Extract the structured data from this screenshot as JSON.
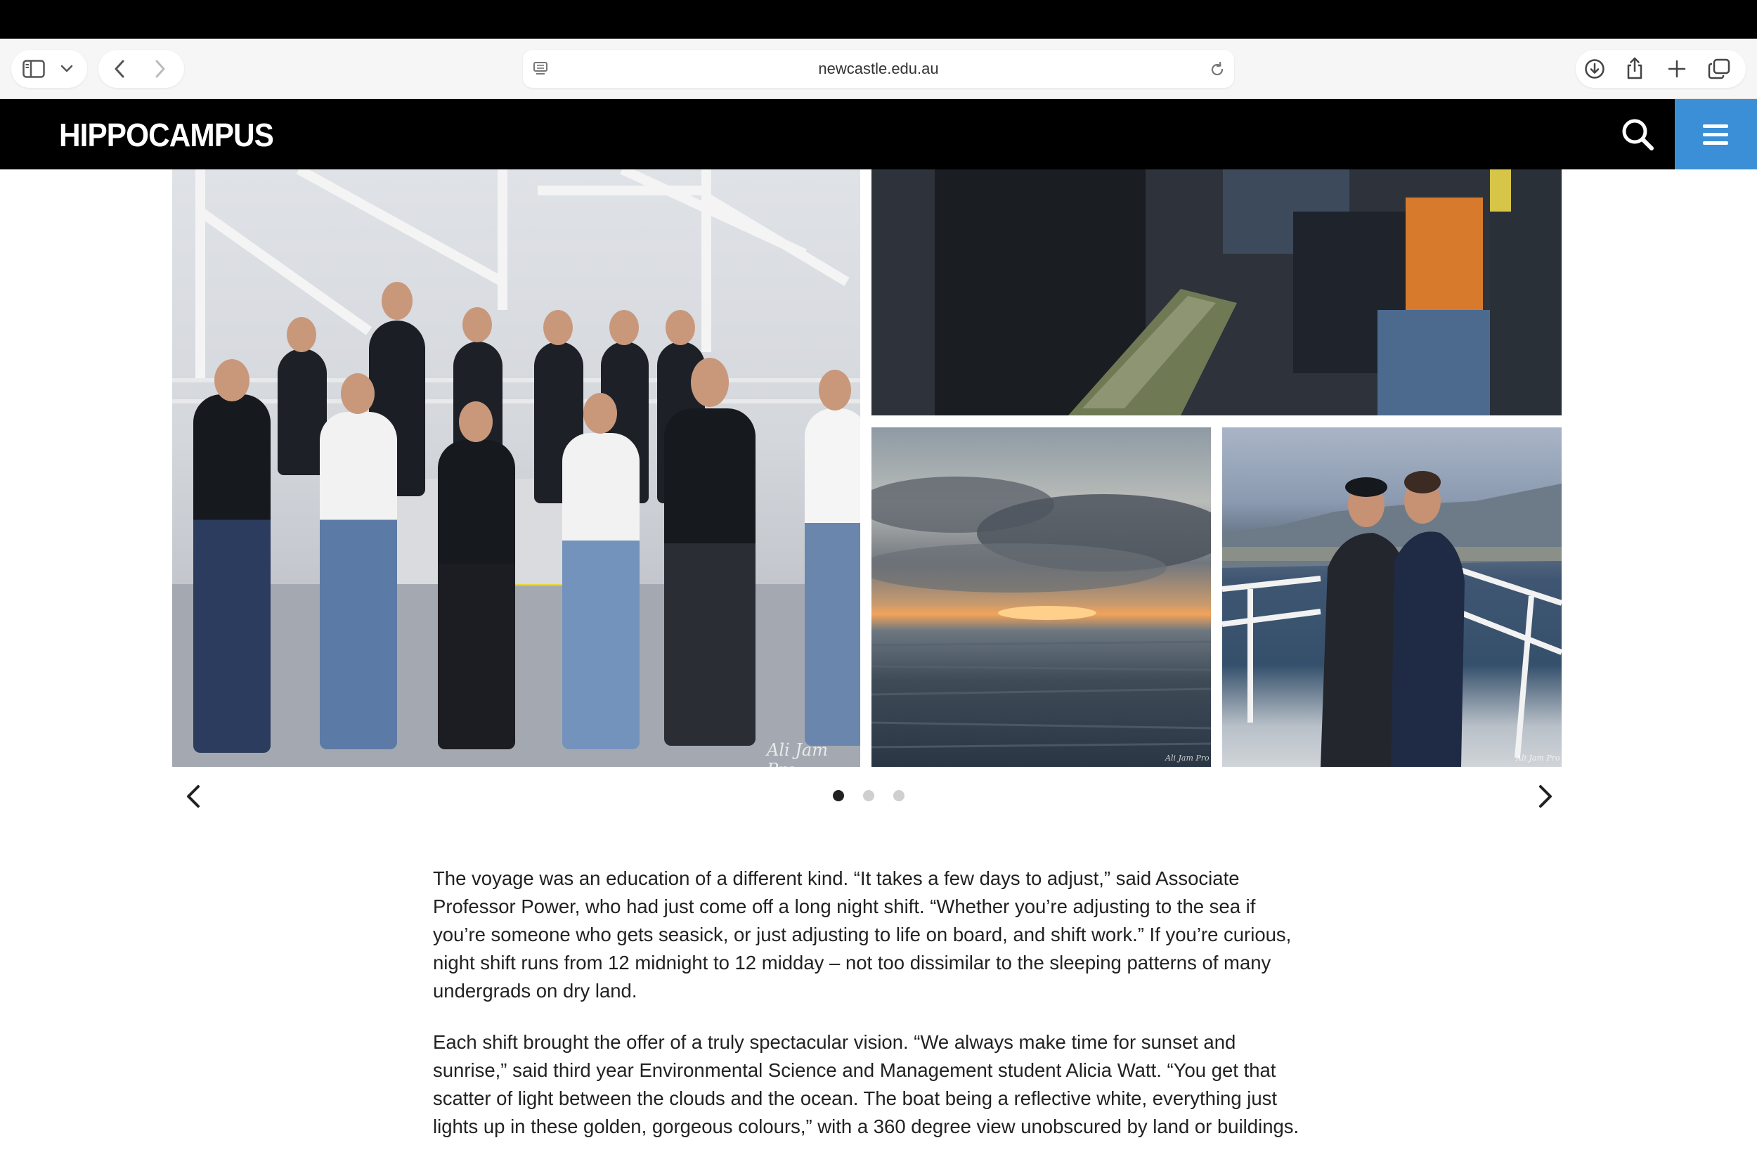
{
  "browser": {
    "url": "newcastle.edu.au"
  },
  "site": {
    "logo_text": "HIPPOCAMPUS",
    "accent_color": "#3a8fd6"
  },
  "gallery": {
    "watermark": "Ali Jam Pro",
    "watermark_main": "Ali Jam Pro",
    "dots": [
      {
        "active": true
      },
      {
        "active": false
      },
      {
        "active": false
      }
    ]
  },
  "article": {
    "paragraphs": [
      "The voyage was an education of a different kind. “It takes a few days to adjust,” said Associate Professor Power, who had just come off a long night shift. “Whether you’re adjusting to the sea if you’re someone who gets seasick, or just adjusting to life on board, and shift work.” If you’re curious, night shift runs from 12 midnight to 12 midday – not too dissimilar to the sleeping patterns of many undergrads on dry land.",
      "Each shift brought the offer of a truly spectacular vision. “We always make time for sunset and sunrise,” said third year Environmental Science and Management student Alicia Watt. “You get that scatter of light between the clouds and the ocean. The boat being a reflective white, everything just lights up in these golden, gorgeous colours,” with a 360 degree view unobscured by land or buildings."
    ]
  }
}
